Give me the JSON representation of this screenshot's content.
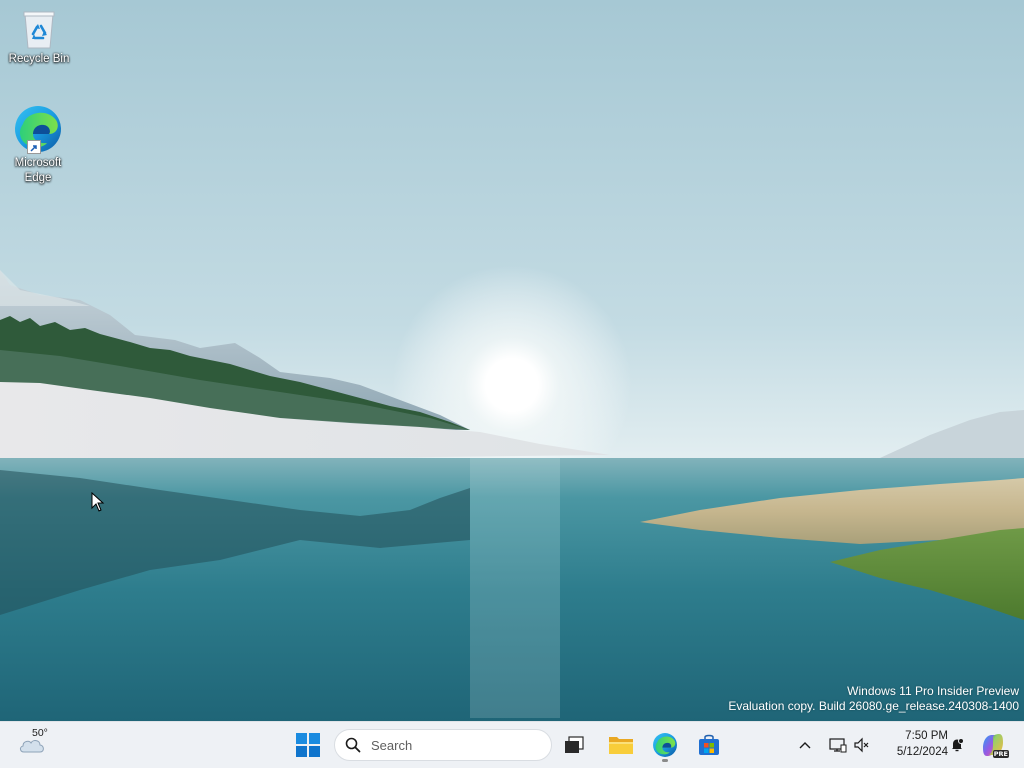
{
  "desktop": {
    "icons": [
      {
        "label": "Recycle Bin",
        "icon": "recycle-bin-icon"
      },
      {
        "label": "Microsoft Edge",
        "icon": "edge-icon"
      }
    ]
  },
  "watermark": {
    "line1": "Windows 11 Pro Insider Preview",
    "line2": "Evaluation copy. Build 26080.ge_release.240308-1400"
  },
  "taskbar": {
    "weather": {
      "temperature": "50°",
      "icon": "cloud-icon"
    },
    "start": {
      "icon": "windows-start-icon"
    },
    "search": {
      "placeholder": "Search",
      "icon": "search-icon"
    },
    "apps": [
      {
        "name": "Task View",
        "icon": "task-view-icon"
      },
      {
        "name": "File Explorer",
        "icon": "folder-icon"
      },
      {
        "name": "Microsoft Edge",
        "icon": "edge-icon"
      },
      {
        "name": "Microsoft Store",
        "icon": "store-icon"
      }
    ],
    "tray": {
      "chevron": "chevron-up-icon",
      "network": "network-icon",
      "volume": "volume-muted-icon",
      "time": "7:50 PM",
      "date": "5/12/2024",
      "notification": "notification-bell-icon",
      "copilot": "copilot-icon",
      "copilot_badge": "PRE"
    }
  },
  "colors": {
    "taskbar_bg": "#eef1f5",
    "windows_blue": "#0078d4",
    "sky_top": "#a9cad6",
    "lake": "#3d8c98"
  }
}
